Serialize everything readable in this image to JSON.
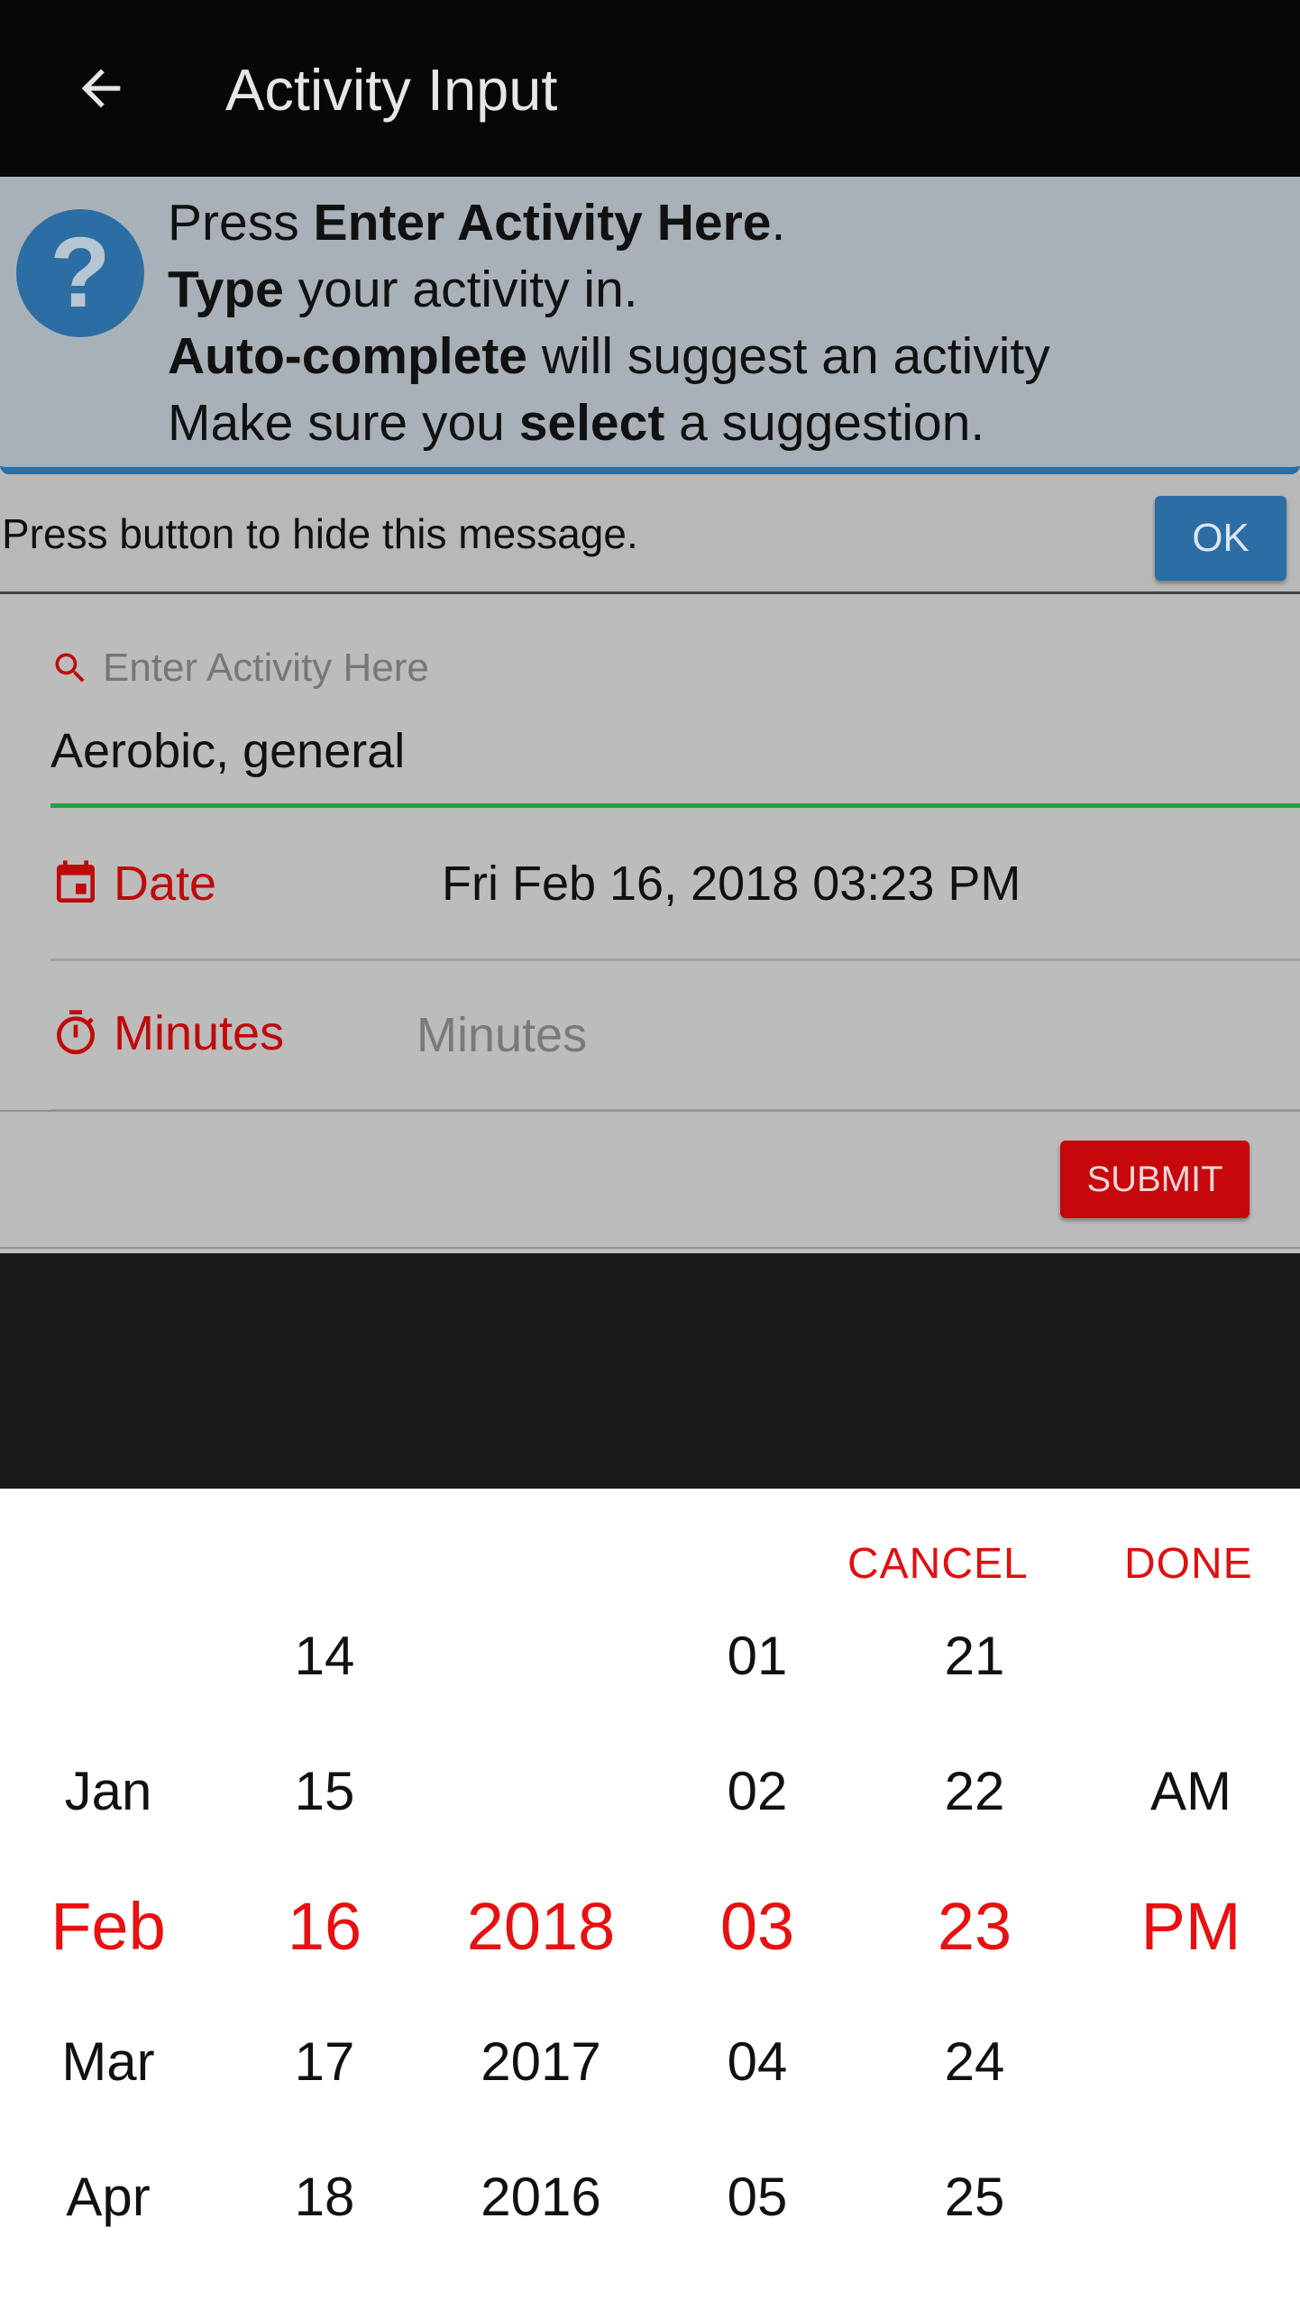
{
  "app_bar": {
    "title": "Activity Input"
  },
  "help": {
    "lines": [
      {
        "pre": "Press ",
        "bold": "Enter Activity Here",
        "post": "."
      },
      {
        "pre": "",
        "bold": "Type",
        "post": " your activity in."
      },
      {
        "pre": "",
        "bold": "Auto-complete",
        "post": " will suggest an activity"
      },
      {
        "pre": "Make sure you ",
        "bold": "select",
        "post": " a suggestion."
      }
    ],
    "hide_text": "Press button to hide this message.",
    "ok_label": "OK"
  },
  "form": {
    "search_label": "Enter Activity Here",
    "search_value": "Aerobic, general",
    "date_label": "Date",
    "date_value": "Fri Feb 16, 2018 03:23 PM",
    "minutes_label": "Minutes",
    "minutes_placeholder": "Minutes",
    "submit_label": "SUBMIT"
  },
  "picker": {
    "cancel_label": "CANCEL",
    "done_label": "DONE",
    "columns": {
      "month": [
        "",
        "Jan",
        "Feb",
        "Mar",
        "Apr"
      ],
      "day": [
        "14",
        "15",
        "16",
        "17",
        "18"
      ],
      "year": [
        "",
        "",
        "2018",
        "2017",
        "2016"
      ],
      "hour": [
        "01",
        "02",
        "03",
        "04",
        "05"
      ],
      "minute": [
        "21",
        "22",
        "23",
        "24",
        "25"
      ],
      "ampm": [
        "",
        "AM",
        "PM",
        "",
        ""
      ]
    },
    "selected_index": 2
  },
  "colors": {
    "accent_red": "#e81010",
    "help_blue": "#2c6ea4",
    "success_green": "#27a243"
  }
}
